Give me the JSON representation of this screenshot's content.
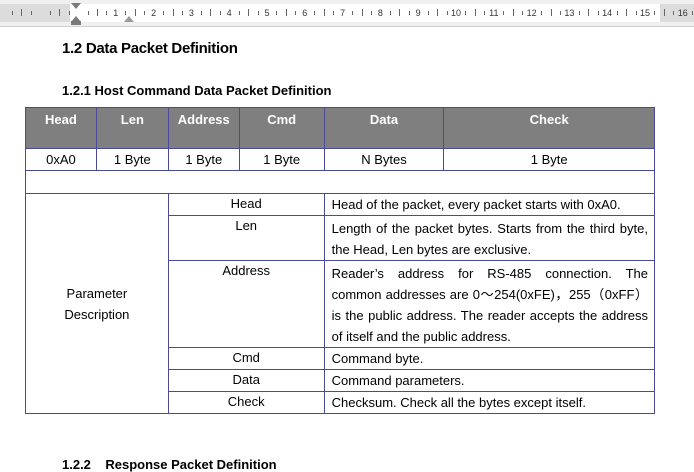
{
  "ruler": {
    "numbers": [
      "1",
      "2",
      "3",
      "4",
      "5",
      "6",
      "7",
      "8",
      "9",
      "10",
      "11",
      "12",
      "13",
      "14",
      "15",
      "16"
    ]
  },
  "doc": {
    "section_title": "1.2 Data Packet Definition",
    "subsection_title": "1.2.1 Host Command Data Packet Definition",
    "next_subsection_title": "1.2.2    Response Packet Definition"
  },
  "table": {
    "headers": [
      "Head",
      "Len",
      "Address",
      "Cmd",
      "Data",
      "Check"
    ],
    "values": [
      "0xA0",
      "1 Byte",
      "1 Byte",
      "1 Byte",
      "N Bytes",
      "1 Byte"
    ],
    "param_label_line1": "Parameter",
    "param_label_line2": "Description",
    "params": [
      {
        "name": "Head",
        "desc": "Head of the packet, every packet starts with 0xA0."
      },
      {
        "name": "Len",
        "desc": "Length of the packet bytes. Starts from the third byte, the Head, Len bytes are exclusive."
      },
      {
        "name": "Address",
        "desc": "Reader’s address for RS-485 connection. The common addresses are 0～254(0xFE)，255（0xFF）is the public address. The reader accepts the address of itself and the public address."
      },
      {
        "name": "Cmd",
        "desc": "Command byte."
      },
      {
        "name": "Data",
        "desc": "Command parameters."
      },
      {
        "name": "Check",
        "desc": "Checksum. Check all the bytes except itself."
      }
    ]
  },
  "colors": {
    "header_bg": "#7f7f7f",
    "border": "#4a4a9a"
  }
}
